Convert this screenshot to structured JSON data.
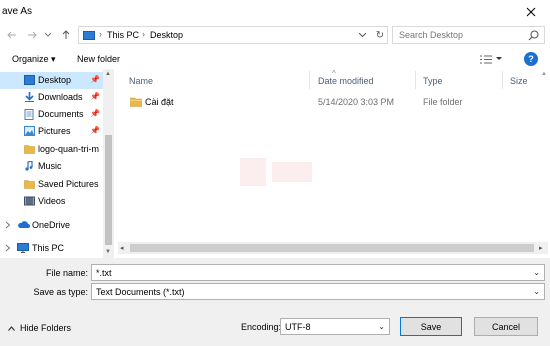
{
  "window": {
    "title": "ave As"
  },
  "address": {
    "crumbs": [
      "This PC",
      "Desktop"
    ],
    "search_placeholder": "Search Desktop"
  },
  "toolbar": {
    "organize": "Organize ▾",
    "new_folder": "New folder"
  },
  "nav": {
    "items": [
      {
        "label": "Desktop",
        "icon": "desktop-icon",
        "pinned": true,
        "selected": true
      },
      {
        "label": "Downloads",
        "icon": "downloads-icon",
        "pinned": true
      },
      {
        "label": "Documents",
        "icon": "documents-icon",
        "pinned": true
      },
      {
        "label": "Pictures",
        "icon": "pictures-icon",
        "pinned": true
      },
      {
        "label": "logo-quan-tri-m",
        "icon": "folder-icon",
        "pinned": false
      },
      {
        "label": "Music",
        "icon": "music-icon",
        "pinned": false
      },
      {
        "label": "Saved Pictures",
        "icon": "folder-icon",
        "pinned": false
      },
      {
        "label": "Videos",
        "icon": "videos-icon",
        "pinned": false
      },
      {
        "label": "OneDrive",
        "icon": "onedrive-icon",
        "pinned": false
      },
      {
        "label": "This PC",
        "icon": "pc-icon",
        "pinned": false
      }
    ]
  },
  "columns": {
    "name": "Name",
    "date": "Date modified",
    "type": "Type",
    "size": "Size"
  },
  "files": [
    {
      "name": "Cài đặt",
      "date": "5/14/2020 3:03 PM",
      "type": "File folder"
    }
  ],
  "form": {
    "filename_label": "File name:",
    "filename_value": "*.txt",
    "savetype_label": "Save as type:",
    "savetype_value": "Text Documents (*.txt)",
    "encoding_label": "Encoding:",
    "encoding_value": "UTF-8",
    "hide_folders": "Hide Folders",
    "save": "Save",
    "cancel": "Cancel"
  },
  "colors": {
    "accent": "#0078d7",
    "selection": "#cce8ff",
    "folder": "#e8b84a"
  }
}
